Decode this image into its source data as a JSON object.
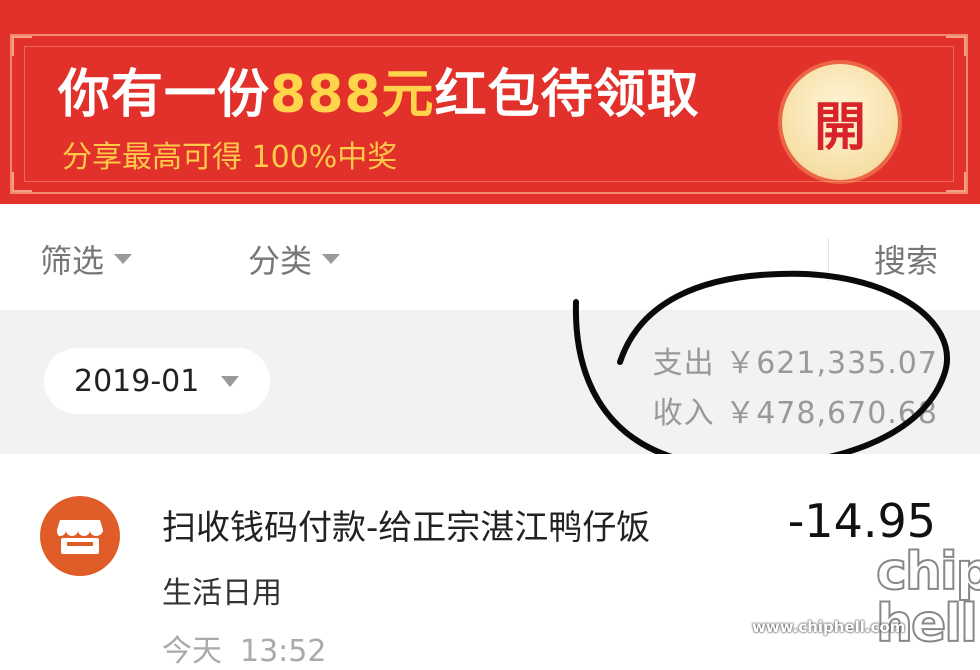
{
  "banner": {
    "title_prefix": "你有一份",
    "title_amount": "888元",
    "title_suffix": "红包待领取",
    "subtitle": "分享最高可得 100%中奖",
    "open_label": "開",
    "bg_color": "#e2312a",
    "accent_color": "#ffd44a"
  },
  "filters": {
    "filter_label": "筛选",
    "category_label": "分类",
    "search_label": "搜索"
  },
  "summary": {
    "month": "2019-01",
    "expense_label": "支出",
    "expense_value": "￥621,335.07",
    "income_label": "收入",
    "income_value": "￥478,670.68"
  },
  "transaction": {
    "icon": "store-icon",
    "title": "扫收钱码付款-给正宗湛江鸭仔饭",
    "amount": "-14.95",
    "category": "生活日用",
    "date": "今天",
    "time": "13:52"
  },
  "watermark": {
    "logo_text": "chip hell",
    "url": "www.chiphell.com"
  }
}
